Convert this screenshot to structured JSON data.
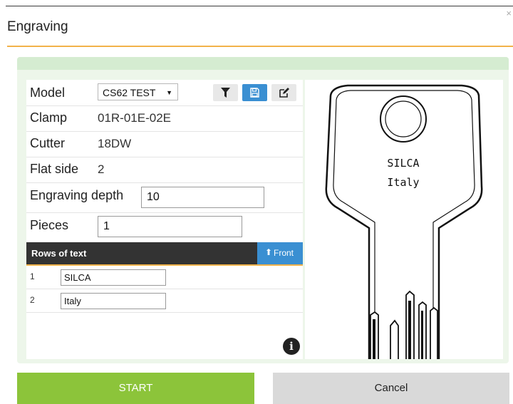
{
  "dialog": {
    "title": "Engraving",
    "close_label": "×"
  },
  "form": {
    "model_label": "Model",
    "model_value": "CS62 TEST",
    "clamp_label": "Clamp",
    "clamp_value": "01R-01E-02E",
    "cutter_label": "Cutter",
    "cutter_value": "18DW",
    "flat_side_label": "Flat side",
    "flat_side_value": "2",
    "depth_label": "Engraving depth",
    "depth_value": "10",
    "pieces_label": "Pieces",
    "pieces_value": "1"
  },
  "toolbar": {
    "icons": [
      "filter-icon",
      "save-icon",
      "edit-icon"
    ],
    "save_color": "#3a8fd2"
  },
  "rows": {
    "header": "Rows of text",
    "front_label": "Front",
    "items": [
      {
        "num": "1",
        "text": "SILCA"
      },
      {
        "num": "2",
        "text": "Italy"
      }
    ]
  },
  "key_preview": {
    "line1": "SILCA",
    "line2": "Italy"
  },
  "actions": {
    "start": "START",
    "cancel": "Cancel"
  },
  "colors": {
    "accent": "#f2b24a",
    "start": "#8cc43a",
    "front": "#3a8fd2"
  }
}
